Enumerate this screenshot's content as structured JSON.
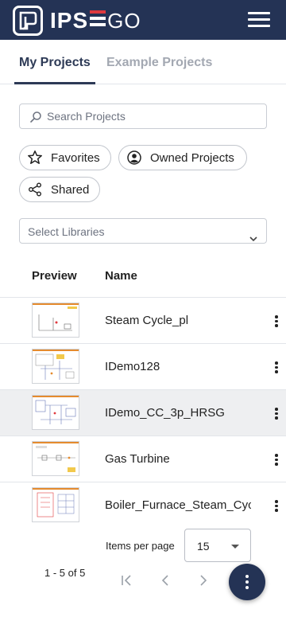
{
  "header": {
    "logo_text_ips": "IPS",
    "logo_text_go": "GO",
    "menu_icon": "hamburger-menu-icon"
  },
  "tabs": [
    {
      "label": "My Projects",
      "active": true
    },
    {
      "label": "Example Projects",
      "active": false
    }
  ],
  "search": {
    "placeholder": "Search Projects",
    "value": "",
    "icon": "search-icon"
  },
  "filters": [
    {
      "label": "Favorites",
      "icon": "star-icon"
    },
    {
      "label": "Owned Projects",
      "icon": "user-circle-icon"
    },
    {
      "label": "Shared",
      "icon": "share-icon"
    }
  ],
  "libraries_select": {
    "placeholder": "Select Libraries",
    "icon": "chevron-down-icon"
  },
  "table": {
    "columns": [
      "Preview",
      "Name"
    ],
    "rows": [
      {
        "name": "Steam Cycle_pl",
        "selected": false
      },
      {
        "name": "IDemo128",
        "selected": false
      },
      {
        "name": "IDemo_CC_3p_HRSG",
        "selected": true
      },
      {
        "name": "Gas Turbine",
        "selected": false
      },
      {
        "name": "Boiler_Furnace_Steam_Cycle",
        "selected": false
      }
    ]
  },
  "pagination": {
    "items_per_page_label": "Items per page",
    "items_per_page_value": "15",
    "range_label": "1 - 5 of 5",
    "first_icon": "first-page-icon",
    "prev_icon": "chevron-left-icon",
    "next_icon": "chevron-right-icon"
  },
  "fab_icon": "more-vertical-icon",
  "colors": {
    "header_bg": "#243355",
    "accent_red": "#e03a3e",
    "tab_active": "#2d3a56",
    "row_selected_bg": "#eeeff1",
    "thumb_accent": "#e58b2e"
  }
}
